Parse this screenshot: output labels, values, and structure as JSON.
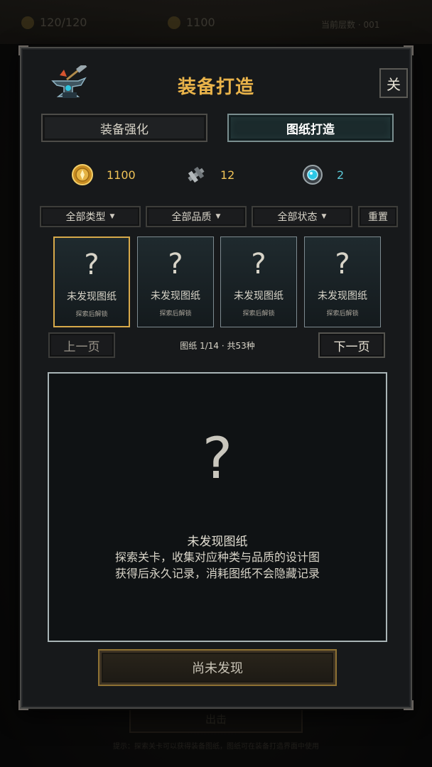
{
  "background": {
    "stamina": "120/120",
    "gold": "1100",
    "right_text": "当前层数 · 001",
    "bottom_button": "出击",
    "footer": "提示：探索关卡可以获得装备图纸，图纸可在装备打造界面中使用"
  },
  "modal": {
    "title": "装备打造",
    "close_label": "关",
    "tabs": [
      {
        "label": "装备强化",
        "active": false
      },
      {
        "label": "图纸打造",
        "active": true
      }
    ],
    "resources": {
      "gold": "1100",
      "material": "12",
      "crystal": "2"
    },
    "filters": {
      "type": "全部类型",
      "quality": "全部品质",
      "status": "全部状态",
      "reset": "重置"
    },
    "cards": [
      {
        "mark": "?",
        "name": "未发现图纸",
        "sub": "探索后解锁",
        "selected": true
      },
      {
        "mark": "?",
        "name": "未发现图纸",
        "sub": "探索后解锁",
        "selected": false
      },
      {
        "mark": "?",
        "name": "未发现图纸",
        "sub": "探索后解锁",
        "selected": false
      },
      {
        "mark": "?",
        "name": "未发现图纸",
        "sub": "探索后解锁",
        "selected": false
      }
    ],
    "pagination": {
      "prev": "上一页",
      "next": "下一页",
      "info": "图纸 1/14 · 共53种"
    },
    "detail": {
      "mark": "?",
      "name": "未发现图纸",
      "line1": "探索关卡，收集对应种类与品质的设计图",
      "line2": "获得后永久记录，消耗图纸不会隐藏记录"
    },
    "action_label": "尚未发现"
  },
  "colors": {
    "title_gold": "#e9b34a",
    "gold_text": "#f0c357",
    "crystal_text": "#5bc7d6",
    "selected_border": "#d7a94a"
  },
  "icons": [
    "anvil-icon",
    "gold-coin-icon",
    "material-icon",
    "crystal-icon"
  ]
}
